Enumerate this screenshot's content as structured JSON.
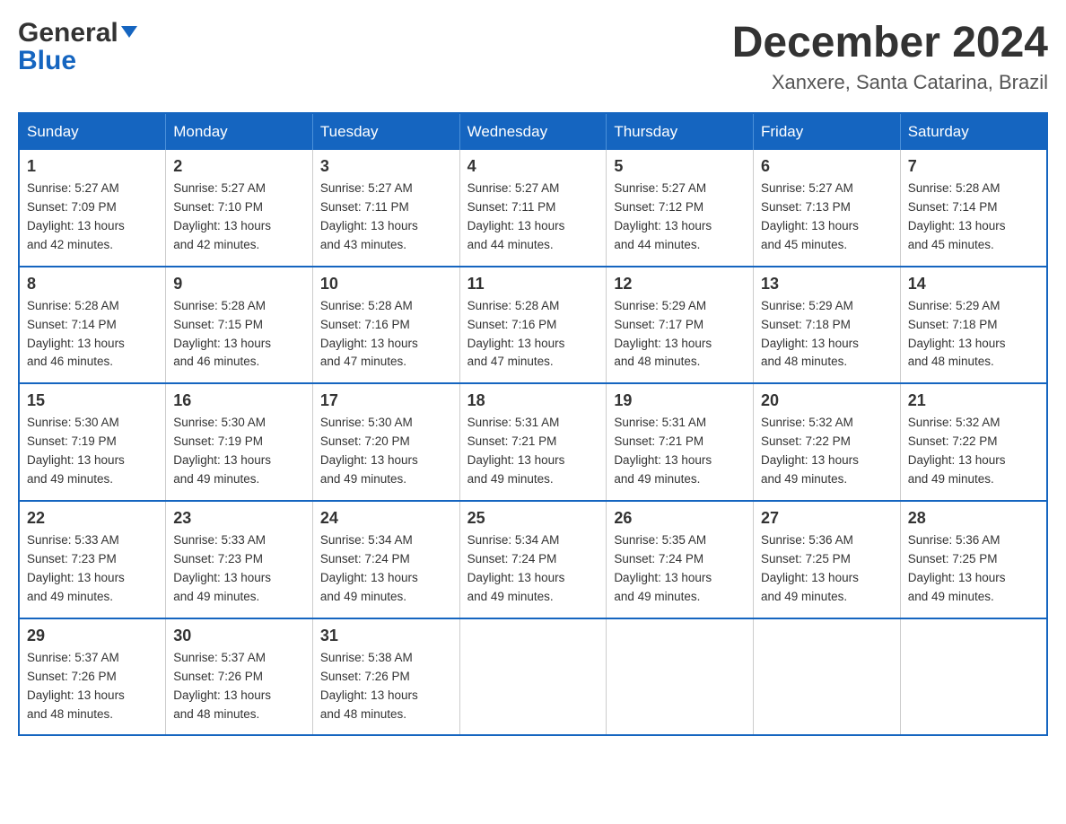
{
  "header": {
    "logo_line1": "General",
    "logo_line2": "Blue",
    "month": "December 2024",
    "location": "Xanxere, Santa Catarina, Brazil"
  },
  "weekdays": [
    "Sunday",
    "Monday",
    "Tuesday",
    "Wednesday",
    "Thursday",
    "Friday",
    "Saturday"
  ],
  "weeks": [
    [
      {
        "day": "1",
        "sunrise": "5:27 AM",
        "sunset": "7:09 PM",
        "daylight": "13 hours and 42 minutes."
      },
      {
        "day": "2",
        "sunrise": "5:27 AM",
        "sunset": "7:10 PM",
        "daylight": "13 hours and 42 minutes."
      },
      {
        "day": "3",
        "sunrise": "5:27 AM",
        "sunset": "7:11 PM",
        "daylight": "13 hours and 43 minutes."
      },
      {
        "day": "4",
        "sunrise": "5:27 AM",
        "sunset": "7:11 PM",
        "daylight": "13 hours and 44 minutes."
      },
      {
        "day": "5",
        "sunrise": "5:27 AM",
        "sunset": "7:12 PM",
        "daylight": "13 hours and 44 minutes."
      },
      {
        "day": "6",
        "sunrise": "5:27 AM",
        "sunset": "7:13 PM",
        "daylight": "13 hours and 45 minutes."
      },
      {
        "day": "7",
        "sunrise": "5:28 AM",
        "sunset": "7:14 PM",
        "daylight": "13 hours and 45 minutes."
      }
    ],
    [
      {
        "day": "8",
        "sunrise": "5:28 AM",
        "sunset": "7:14 PM",
        "daylight": "13 hours and 46 minutes."
      },
      {
        "day": "9",
        "sunrise": "5:28 AM",
        "sunset": "7:15 PM",
        "daylight": "13 hours and 46 minutes."
      },
      {
        "day": "10",
        "sunrise": "5:28 AM",
        "sunset": "7:16 PM",
        "daylight": "13 hours and 47 minutes."
      },
      {
        "day": "11",
        "sunrise": "5:28 AM",
        "sunset": "7:16 PM",
        "daylight": "13 hours and 47 minutes."
      },
      {
        "day": "12",
        "sunrise": "5:29 AM",
        "sunset": "7:17 PM",
        "daylight": "13 hours and 48 minutes."
      },
      {
        "day": "13",
        "sunrise": "5:29 AM",
        "sunset": "7:18 PM",
        "daylight": "13 hours and 48 minutes."
      },
      {
        "day": "14",
        "sunrise": "5:29 AM",
        "sunset": "7:18 PM",
        "daylight": "13 hours and 48 minutes."
      }
    ],
    [
      {
        "day": "15",
        "sunrise": "5:30 AM",
        "sunset": "7:19 PM",
        "daylight": "13 hours and 49 minutes."
      },
      {
        "day": "16",
        "sunrise": "5:30 AM",
        "sunset": "7:19 PM",
        "daylight": "13 hours and 49 minutes."
      },
      {
        "day": "17",
        "sunrise": "5:30 AM",
        "sunset": "7:20 PM",
        "daylight": "13 hours and 49 minutes."
      },
      {
        "day": "18",
        "sunrise": "5:31 AM",
        "sunset": "7:21 PM",
        "daylight": "13 hours and 49 minutes."
      },
      {
        "day": "19",
        "sunrise": "5:31 AM",
        "sunset": "7:21 PM",
        "daylight": "13 hours and 49 minutes."
      },
      {
        "day": "20",
        "sunrise": "5:32 AM",
        "sunset": "7:22 PM",
        "daylight": "13 hours and 49 minutes."
      },
      {
        "day": "21",
        "sunrise": "5:32 AM",
        "sunset": "7:22 PM",
        "daylight": "13 hours and 49 minutes."
      }
    ],
    [
      {
        "day": "22",
        "sunrise": "5:33 AM",
        "sunset": "7:23 PM",
        "daylight": "13 hours and 49 minutes."
      },
      {
        "day": "23",
        "sunrise": "5:33 AM",
        "sunset": "7:23 PM",
        "daylight": "13 hours and 49 minutes."
      },
      {
        "day": "24",
        "sunrise": "5:34 AM",
        "sunset": "7:24 PM",
        "daylight": "13 hours and 49 minutes."
      },
      {
        "day": "25",
        "sunrise": "5:34 AM",
        "sunset": "7:24 PM",
        "daylight": "13 hours and 49 minutes."
      },
      {
        "day": "26",
        "sunrise": "5:35 AM",
        "sunset": "7:24 PM",
        "daylight": "13 hours and 49 minutes."
      },
      {
        "day": "27",
        "sunrise": "5:36 AM",
        "sunset": "7:25 PM",
        "daylight": "13 hours and 49 minutes."
      },
      {
        "day": "28",
        "sunrise": "5:36 AM",
        "sunset": "7:25 PM",
        "daylight": "13 hours and 49 minutes."
      }
    ],
    [
      {
        "day": "29",
        "sunrise": "5:37 AM",
        "sunset": "7:26 PM",
        "daylight": "13 hours and 48 minutes."
      },
      {
        "day": "30",
        "sunrise": "5:37 AM",
        "sunset": "7:26 PM",
        "daylight": "13 hours and 48 minutes."
      },
      {
        "day": "31",
        "sunrise": "5:38 AM",
        "sunset": "7:26 PM",
        "daylight": "13 hours and 48 minutes."
      },
      null,
      null,
      null,
      null
    ]
  ],
  "labels": {
    "sunrise": "Sunrise:",
    "sunset": "Sunset:",
    "daylight": "Daylight:"
  }
}
